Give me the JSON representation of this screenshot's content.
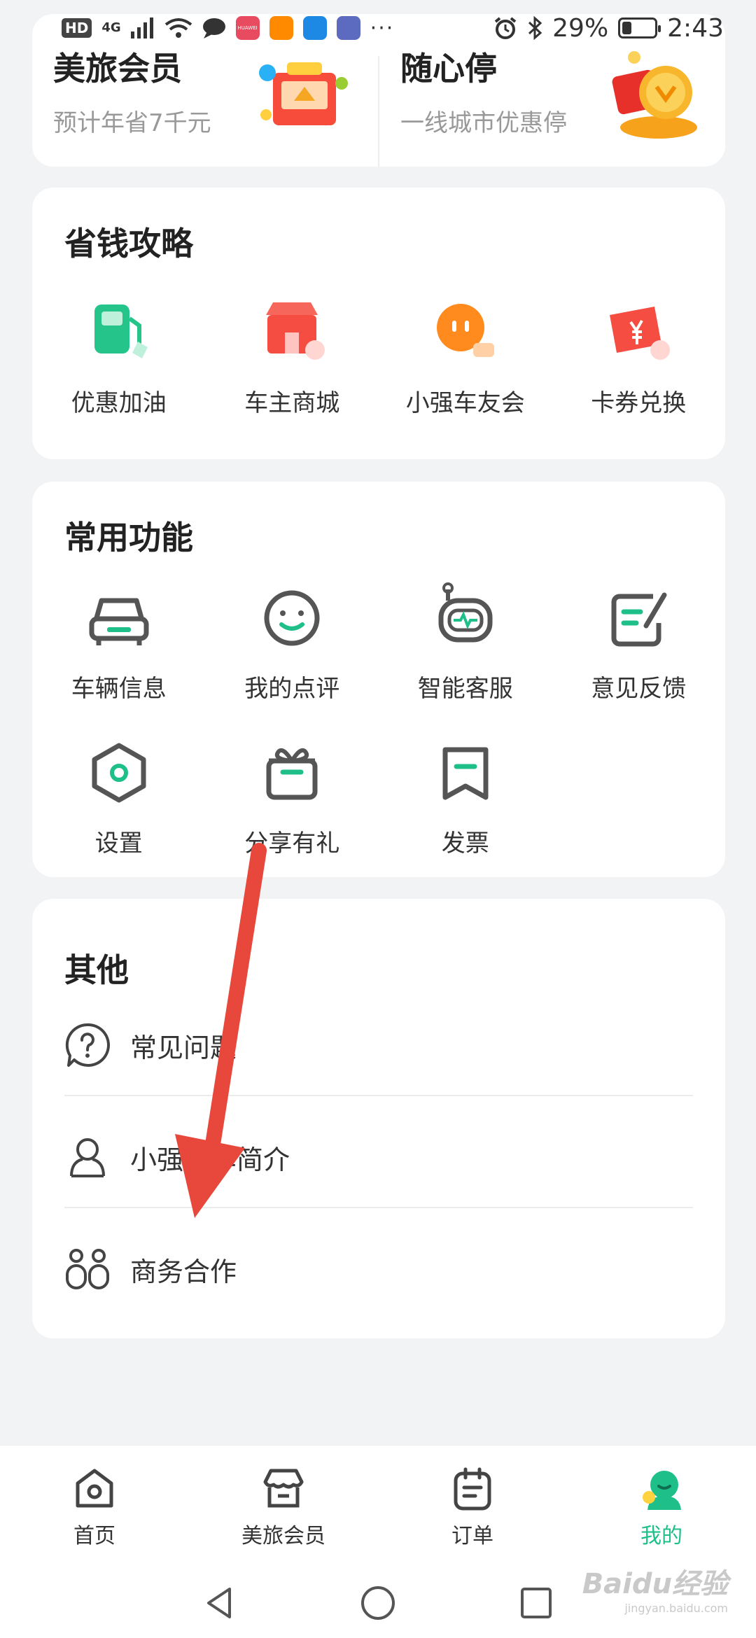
{
  "status_bar": {
    "hd": "HD",
    "network": "4G",
    "dots": "···",
    "battery_percent": "29%",
    "battery_level": 0.29,
    "time": "2:43",
    "brand_badge": "HUAWEI"
  },
  "top_promos": [
    {
      "title": "美旅会员",
      "subtitle": "预计年省7千元",
      "icon": "gift-box-icon"
    },
    {
      "title": "随心停",
      "subtitle": "一线城市优惠停",
      "icon": "coin-envelope-icon"
    }
  ],
  "save_section": {
    "title": "省钱攻略",
    "items": [
      {
        "label": "优惠加油",
        "icon": "fuel-pump-icon"
      },
      {
        "label": "车主商城",
        "icon": "shop-icon"
      },
      {
        "label": "小强车友会",
        "icon": "chat-bubble-icon"
      },
      {
        "label": "卡券兑换",
        "icon": "coupon-icon"
      }
    ]
  },
  "common_section": {
    "title": "常用功能",
    "items": [
      {
        "label": "车辆信息",
        "icon": "car-icon"
      },
      {
        "label": "我的点评",
        "icon": "smile-icon"
      },
      {
        "label": "智能客服",
        "icon": "robot-icon"
      },
      {
        "label": "意见反馈",
        "icon": "edit-icon"
      },
      {
        "label": "设置",
        "icon": "settings-hex-icon"
      },
      {
        "label": "分享有礼",
        "icon": "gift-icon"
      },
      {
        "label": "发票",
        "icon": "invoice-icon"
      }
    ]
  },
  "other_section": {
    "title": "其他",
    "items": [
      {
        "label": "常见问题",
        "icon": "question-icon"
      },
      {
        "label": "小强停车简介",
        "icon": "person-icon"
      },
      {
        "label": "商务合作",
        "icon": "partners-icon"
      }
    ]
  },
  "bottom_nav": [
    {
      "label": "首页",
      "icon": "home-icon",
      "active": false
    },
    {
      "label": "美旅会员",
      "icon": "store-icon",
      "active": false
    },
    {
      "label": "订单",
      "icon": "calendar-icon",
      "active": false
    },
    {
      "label": "我的",
      "icon": "profile-icon",
      "active": true
    }
  ],
  "watermark": {
    "brand": "Baidu经验",
    "url": "jingyan.baidu.com"
  },
  "colors": {
    "accent": "#1fbf8a",
    "arrow": "#e8473b",
    "background": "#f2f3f5"
  }
}
